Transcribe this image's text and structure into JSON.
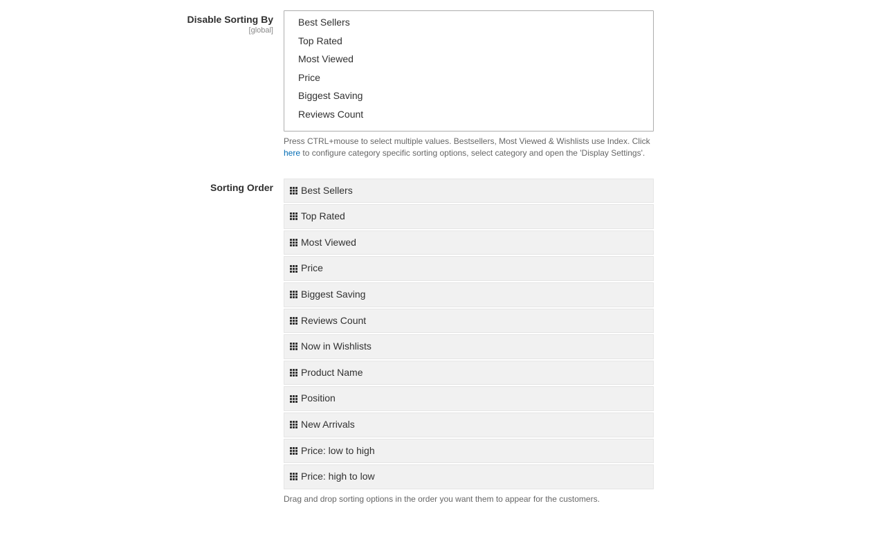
{
  "disableSorting": {
    "label": "Disable Sorting By",
    "scope": "[global]",
    "options": [
      "Best Sellers",
      "Top Rated",
      "Most Viewed",
      "Price",
      "Biggest Saving",
      "Reviews Count"
    ],
    "helpText1": "Press CTRL+mouse to select multiple values. Bestsellers, Most Viewed & Wishlists use Index. Click ",
    "helpLink": "here",
    "helpText2": " to configure category specific sorting options, select category and open the 'Display Settings'."
  },
  "sortingOrder": {
    "label": "Sorting Order",
    "items": [
      "Best Sellers",
      "Top Rated",
      "Most Viewed",
      "Price",
      "Biggest Saving",
      "Reviews Count",
      "Now in Wishlists",
      "Product Name",
      "Position",
      "New Arrivals",
      "Price: low to high",
      "Price: high to low"
    ],
    "helpText": "Drag and drop sorting options in the order you want them to appear for the customers."
  }
}
